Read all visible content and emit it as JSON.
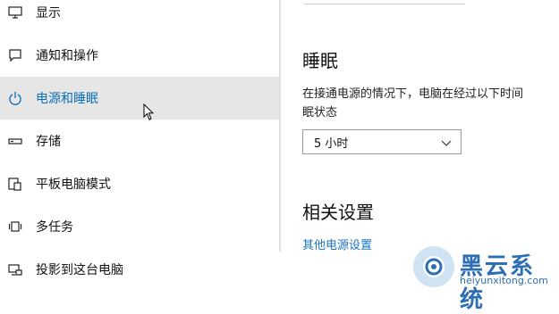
{
  "sidebar": {
    "items": [
      {
        "label": "显示",
        "icon": "monitor-icon"
      },
      {
        "label": "通知和操作",
        "icon": "message-icon"
      },
      {
        "label": "电源和睡眠",
        "icon": "power-icon",
        "active": true
      },
      {
        "label": "存储",
        "icon": "drive-icon"
      },
      {
        "label": "平板电脑模式",
        "icon": "tablet-icon"
      },
      {
        "label": "多任务",
        "icon": "multitask-icon"
      },
      {
        "label": "投影到这台电脑",
        "icon": "project-icon"
      }
    ]
  },
  "sleep": {
    "title": "睡眠",
    "desc_line1": "在接通电源的情况下，电脑在经过以下时间",
    "desc_line2": "眠状态",
    "selected": "5 小时"
  },
  "related": {
    "title": "相关设置",
    "link": "其他电源设置"
  },
  "watermark": {
    "brand": "黑云系统",
    "url": "heiyunxitong.com"
  },
  "colors": {
    "accent": "#0a6fb8",
    "active_bg": "#e6e6e6",
    "link": "#1a73c0",
    "watermark": "#2d6fb2"
  }
}
